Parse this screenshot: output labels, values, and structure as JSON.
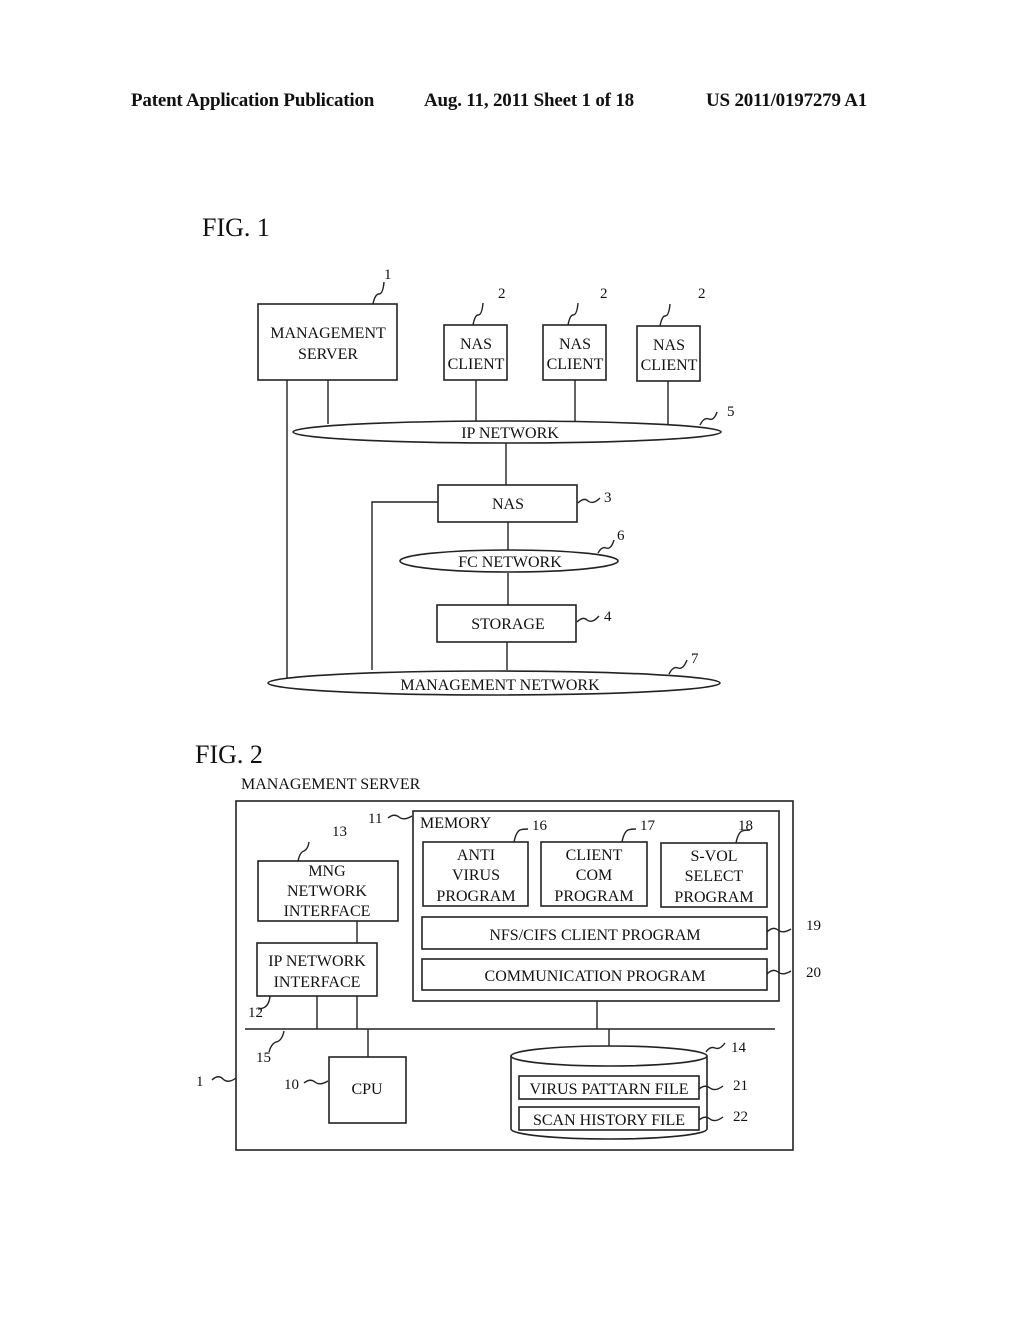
{
  "header": {
    "publication": "Patent Application Publication",
    "date_sheet": "Aug. 11, 2011  Sheet 1 of 18",
    "number": "US 2011/0197279 A1"
  },
  "fig1": {
    "title": "FIG. 1",
    "management_server": [
      "MANAGEMENT",
      "SERVER"
    ],
    "nas_client": [
      "NAS",
      "CLIENT"
    ],
    "ip_network": "IP NETWORK",
    "nas": "NAS",
    "fc_network": "FC NETWORK",
    "storage": "STORAGE",
    "management_network": "MANAGEMENT NETWORK",
    "refs": {
      "server": "1",
      "client": "2",
      "nas": "3",
      "storage": "4",
      "ip": "5",
      "fc": "6",
      "mgmt": "7"
    }
  },
  "fig2": {
    "title": "FIG. 2",
    "caption": "MANAGEMENT SERVER",
    "memory": "MEMORY",
    "anti_virus": [
      "ANTI",
      "VIRUS",
      "PROGRAM"
    ],
    "client_com": [
      "CLIENT",
      "COM",
      "PROGRAM"
    ],
    "svol_select": [
      "S-VOL",
      "SELECT",
      "PROGRAM"
    ],
    "nfs_cifs": "NFS/CIFS CLIENT PROGRAM",
    "communication": "COMMUNICATION PROGRAM",
    "mng_if": [
      "MNG",
      "NETWORK",
      "INTERFACE"
    ],
    "ip_if": [
      "IP NETWORK",
      "INTERFACE"
    ],
    "cpu": "CPU",
    "virus_file": "VIRUS PATTARN FILE",
    "scan_file": "SCAN HISTORY FILE",
    "refs": {
      "server": "1",
      "cpu": "10",
      "memory": "11",
      "ip_if": "12",
      "mng_if": "13",
      "disk": "14",
      "bus": "15",
      "anti": "16",
      "client_com": "17",
      "svol": "18",
      "nfs": "19",
      "comm": "20",
      "virus": "21",
      "scan": "22"
    }
  }
}
